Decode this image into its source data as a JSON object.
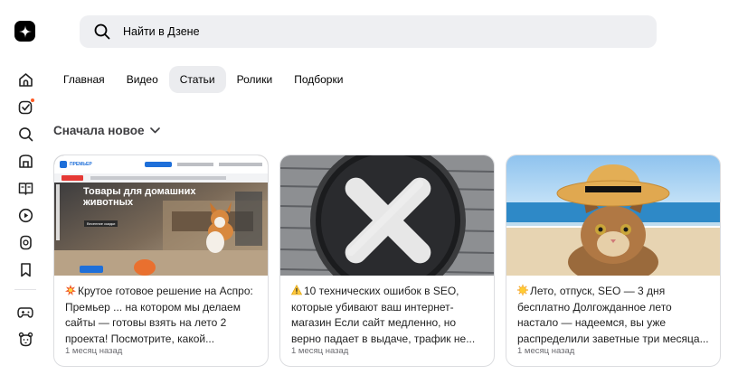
{
  "search": {
    "placeholder": "Найти в Дзене"
  },
  "sidebar": {
    "items": [
      {
        "icon": "home-icon"
      },
      {
        "icon": "subscriptions-icon",
        "badge": true
      },
      {
        "icon": "search-icon"
      },
      {
        "icon": "store-icon"
      },
      {
        "icon": "articles-icon"
      },
      {
        "icon": "video-icon"
      },
      {
        "icon": "shorts-icon"
      },
      {
        "icon": "bookmark-icon"
      },
      {
        "icon": "gamepad-icon"
      },
      {
        "icon": "kids-icon"
      }
    ]
  },
  "tabs": [
    {
      "label": "Главная",
      "active": false
    },
    {
      "label": "Видео",
      "active": false
    },
    {
      "label": "Статьи",
      "active": true
    },
    {
      "label": "Ролики",
      "active": false
    },
    {
      "label": "Подборки",
      "active": false
    }
  ],
  "sort": {
    "label": "Сначала новое"
  },
  "cards": [
    {
      "emoji": "boom-emoji",
      "title": "Крутое готовое решение на Аспро: Премьер ... на котором мы делаем сайты — готовы взять на лето 2 проекта! Посмотрите, какой...",
      "date": "1 месяц назад",
      "thumb": {
        "headline": "Товары для домашних животных",
        "site": "ПРЕМЬЕР",
        "badge": "Весенние скидки"
      }
    },
    {
      "emoji": "warning-emoji",
      "title": "10 технических ошибок в SEO, которые убивают ваш интернет-магазин Если сайт медленно, но верно падает в выдаче, трафик не...",
      "date": "1 месяц назад"
    },
    {
      "emoji": "sun-emoji",
      "title": "Лето, отпуск, SEO — 3 дня бесплатно Долгожданное лето настало — надеемся, вы уже распределили заветные три месяца...",
      "date": "1 месяц назад"
    }
  ],
  "colors": {
    "accent": "#ff5a24",
    "search_bg": "#eeeff2",
    "tab_active_bg": "#ebecef"
  }
}
